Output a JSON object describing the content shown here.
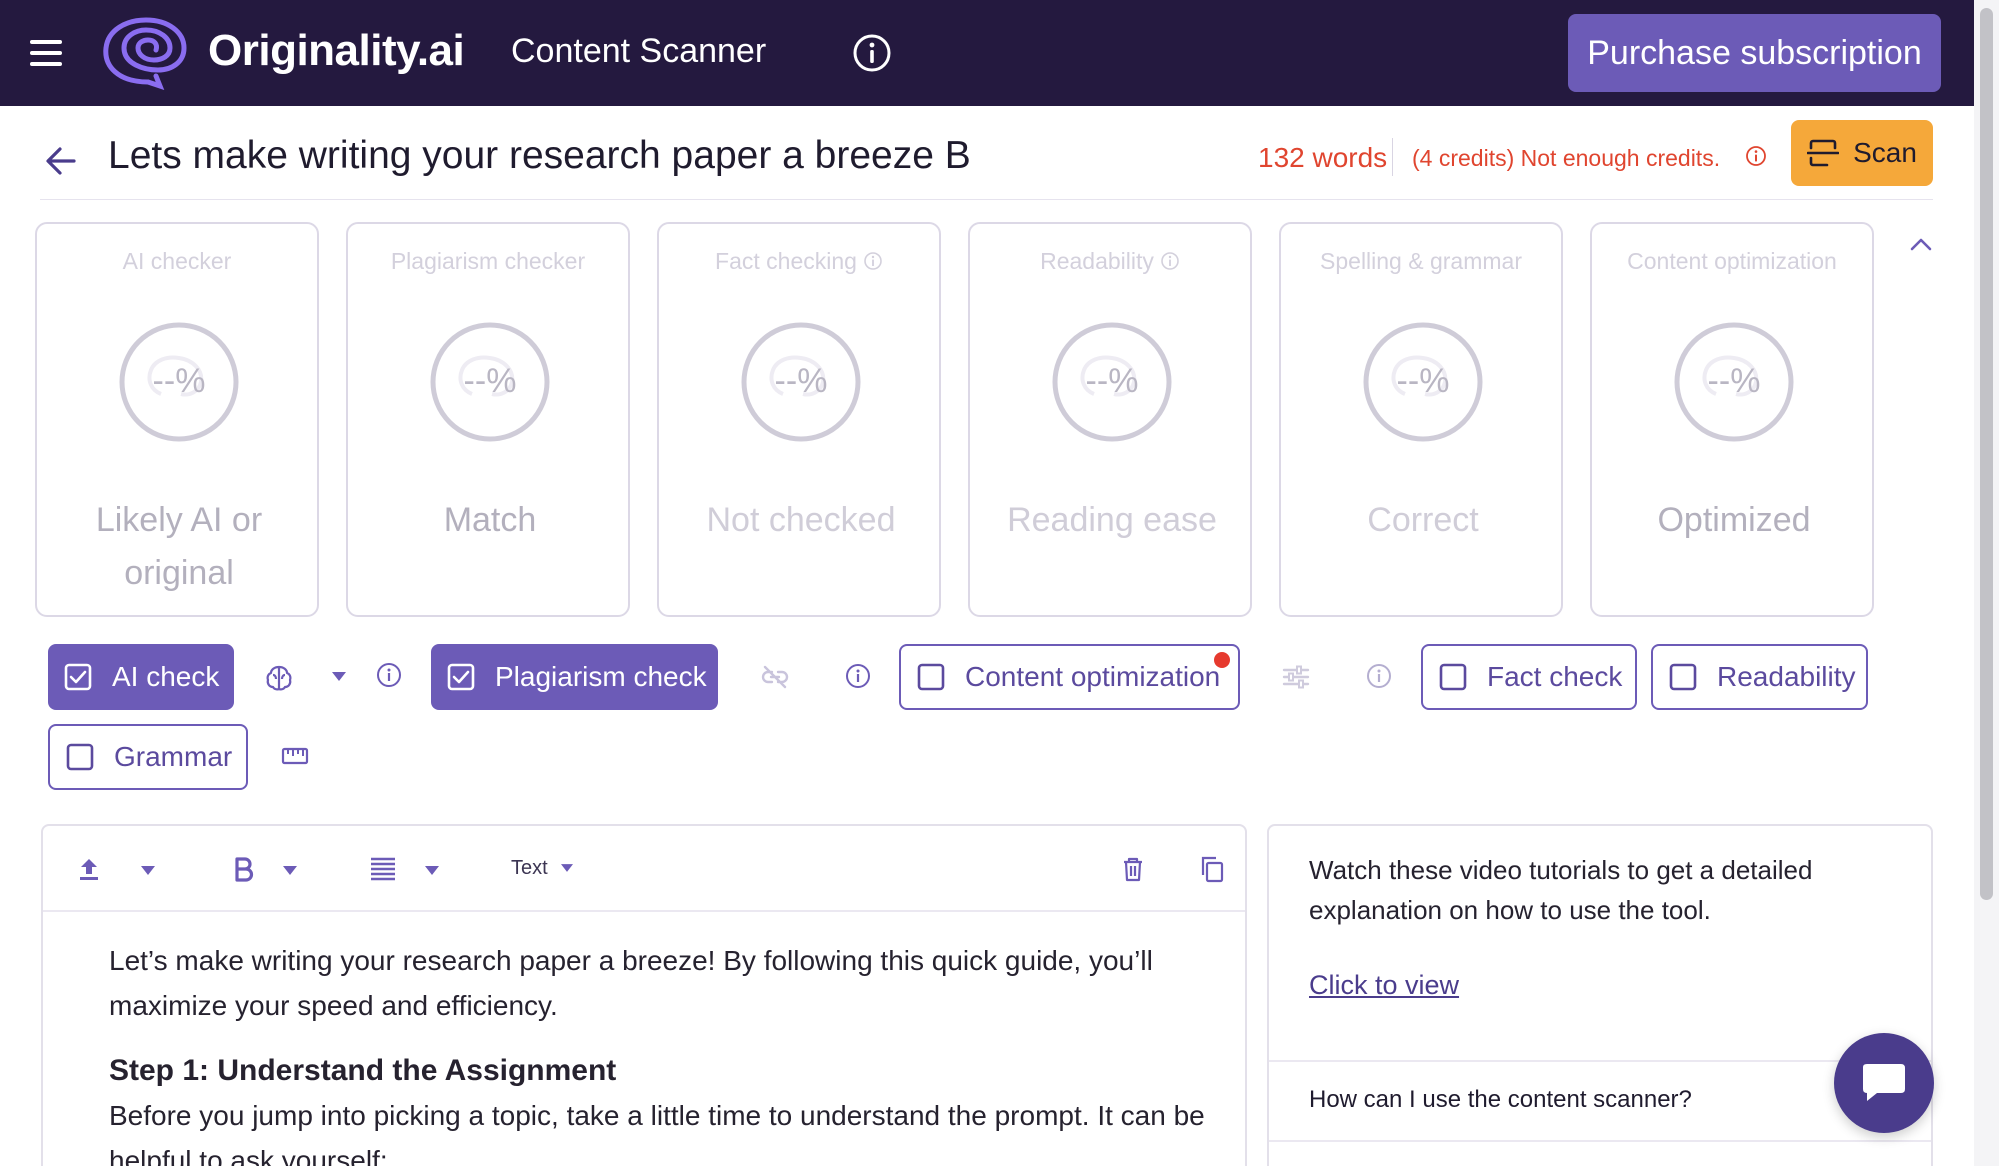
{
  "header": {
    "brand": "Originality.ai",
    "app_title": "Content Scanner",
    "purchase_label": "Purchase subscription",
    "icons": {
      "menu": "hamburger-icon",
      "logo": "brain-swirl-logo",
      "info": "info-icon"
    }
  },
  "document": {
    "title": "Lets make writing your research paper a breeze B",
    "word_count": "132 words",
    "credits_message": "(4 credits) Not enough credits.",
    "scan_label": "Scan"
  },
  "cards": [
    {
      "label": "AI checker",
      "value": "--%",
      "result": "Likely AI or original",
      "info": false
    },
    {
      "label": "Plagiarism checker",
      "value": "--%",
      "result": "Match",
      "info": false
    },
    {
      "label": "Fact checking",
      "value": "--%",
      "result": "Not checked",
      "info": true
    },
    {
      "label": "Readability",
      "value": "--%",
      "result": "Reading ease",
      "info": true
    },
    {
      "label": "Spelling & grammar",
      "value": "--%",
      "result": "Correct",
      "info": false
    },
    {
      "label": "Content optimization",
      "value": "--%",
      "result": "Optimized",
      "info": false
    }
  ],
  "checks": {
    "ai": {
      "label": "AI check",
      "checked": true
    },
    "plagiarism": {
      "label": "Plagiarism check",
      "checked": true
    },
    "content_optimization": {
      "label": "Content optimization",
      "checked": false
    },
    "fact": {
      "label": "Fact check",
      "checked": false
    },
    "readability": {
      "label": "Readability",
      "checked": false
    },
    "grammar": {
      "label": "Grammar",
      "checked": false
    }
  },
  "editor": {
    "toolbar": {
      "text_style": "Text"
    },
    "paragraph1": "Let’s make writing your research paper a breeze! By following this quick guide, you’ll maximize your speed and efficiency.",
    "heading1": "Step 1: Understand the Assignment",
    "paragraph2": "Before you jump into picking a topic, take a little time to understand the prompt. It can be helpful to ask yourself:"
  },
  "side_panel": {
    "intro": "Watch these video tutorials to get a detailed explanation on how to use the tool.",
    "link": "Click to view",
    "faq": [
      "How can I use the content scanner?"
    ]
  },
  "colors": {
    "header_bg": "#24193f",
    "accent": "#6c5bb7",
    "scan_button": "#f5a83a",
    "warning_text": "#e0452f"
  }
}
